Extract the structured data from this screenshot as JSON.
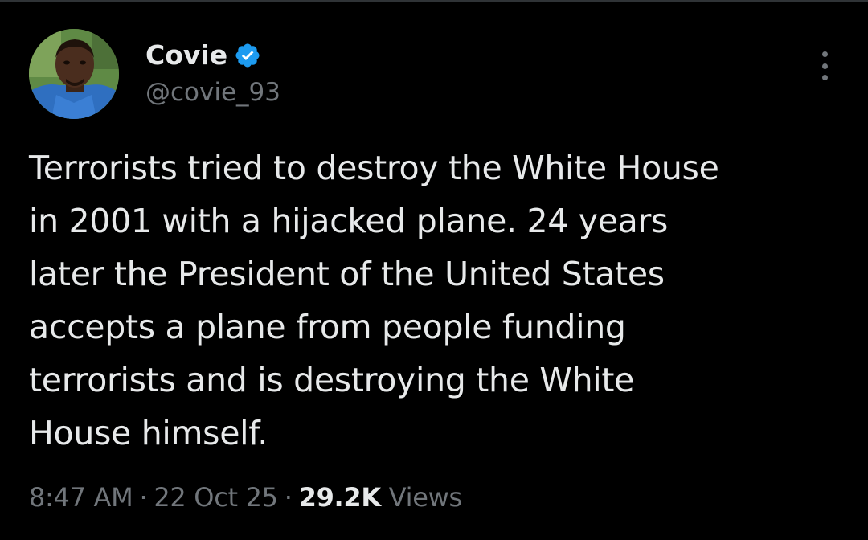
{
  "author": {
    "display_name": "Covie",
    "handle": "@covie_93",
    "verified": true,
    "verified_color": "#1d9bf0"
  },
  "tweet": {
    "text_lines": [
      "Terrorists tried to destroy the White House",
      "in 2001 with a hijacked plane. 24 years",
      "later the President of the United States",
      "accepts a plane from people funding",
      "terrorists and is destroying the White",
      "House himself."
    ]
  },
  "meta": {
    "time": "8:47 AM",
    "separator": "·",
    "date": "22 Oct 25",
    "views_count": "29.2K",
    "views_label": "Views"
  },
  "icons": {
    "more": "more-horizontal-icon",
    "verified": "verified-badge-icon"
  },
  "colors": {
    "background": "#000000",
    "primary_text": "#e7e9ea",
    "secondary_text": "#71767b",
    "accent": "#1d9bf0"
  }
}
